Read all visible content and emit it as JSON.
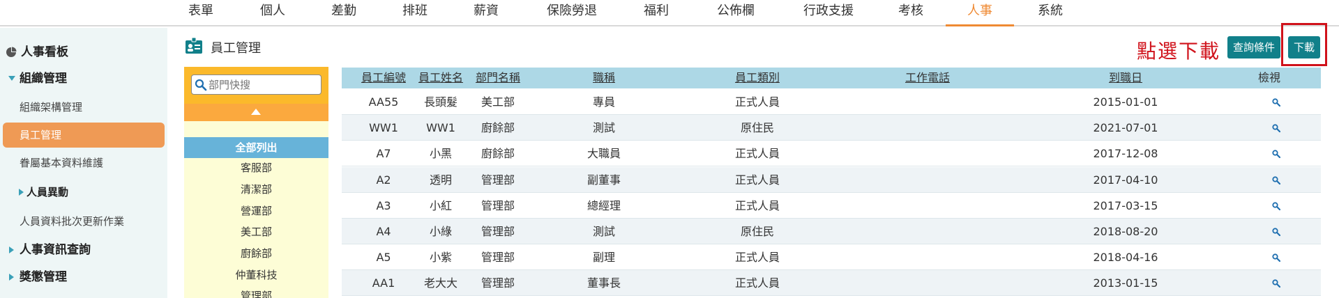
{
  "nav": {
    "items": [
      "表單",
      "個人",
      "差勤",
      "排班",
      "薪資",
      "保險勞退",
      "福利",
      "公佈欄",
      "行政支援",
      "考核",
      "人事",
      "系統"
    ],
    "active_index": 10
  },
  "sidebar": {
    "items": [
      {
        "label": "人事看板"
      },
      {
        "label": "組織管理"
      },
      {
        "label": "組織架構管理"
      },
      {
        "label": "員工管理"
      },
      {
        "label": "眷屬基本資料維護"
      },
      {
        "label": "人員異動"
      },
      {
        "label": "人員資料批次更新作業"
      },
      {
        "label": "人事資訊查詢"
      },
      {
        "label": "獎懲管理"
      }
    ]
  },
  "page": {
    "title": "員工管理",
    "annotation": "點選下載",
    "query_button": "查詢條件",
    "download_button": "下載"
  },
  "dept_panel": {
    "search_placeholder": "部門快搜",
    "all_label": "全部列出",
    "departments": [
      "客服部",
      "清潔部",
      "營運部",
      "美工部",
      "廚餘部",
      "仲董科技",
      "管理部"
    ]
  },
  "table": {
    "headers": [
      "員工編號",
      "員工姓名",
      "部門名稱",
      "職稱",
      "員工類別",
      "工作電話",
      "到職日",
      "檢視"
    ],
    "rows": [
      [
        "AA55",
        "長頭髮",
        "美工部",
        "專員",
        "正式人員",
        "",
        "2015-01-01"
      ],
      [
        "WW1",
        "WW1",
        "廚餘部",
        "測試",
        "原住民",
        "",
        "2021-07-01"
      ],
      [
        "A7",
        "小黑",
        "廚餘部",
        "大職員",
        "正式人員",
        "",
        "2017-12-08"
      ],
      [
        "A2",
        "透明",
        "管理部",
        "副董事",
        "正式人員",
        "",
        "2017-04-10"
      ],
      [
        "A3",
        "小紅",
        "管理部",
        "總經理",
        "正式人員",
        "",
        "2017-03-15"
      ],
      [
        "A4",
        "小綠",
        "管理部",
        "測試",
        "原住民",
        "",
        "2018-08-20"
      ],
      [
        "A5",
        "小紫",
        "管理部",
        "副理",
        "正式人員",
        "",
        "2018-04-16"
      ],
      [
        "AA1",
        "老大大",
        "管理部",
        "董事長",
        "正式人員",
        "",
        "2013-01-15"
      ]
    ]
  },
  "colors": {
    "accent": "#ef8a33",
    "button": "#11808a",
    "annotation": "#d0121b",
    "header_bg": "#add8e6"
  }
}
